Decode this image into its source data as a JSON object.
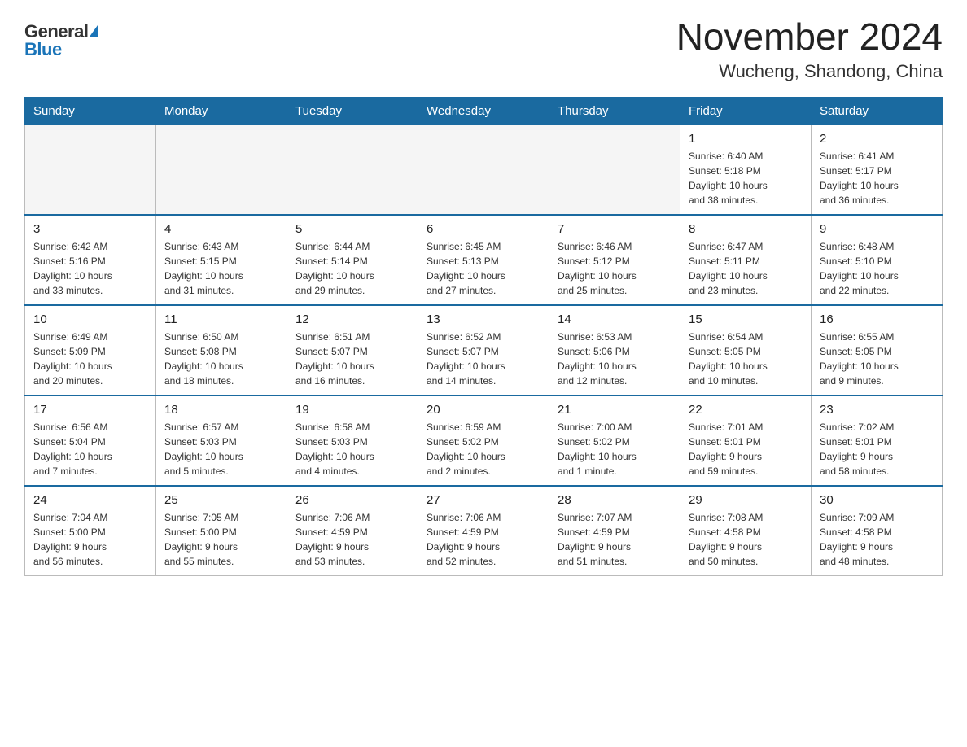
{
  "logo": {
    "general": "General",
    "blue": "Blue"
  },
  "title": "November 2024",
  "location": "Wucheng, Shandong, China",
  "weekdays": [
    "Sunday",
    "Monday",
    "Tuesday",
    "Wednesday",
    "Thursday",
    "Friday",
    "Saturday"
  ],
  "weeks": [
    [
      {
        "day": "",
        "info": ""
      },
      {
        "day": "",
        "info": ""
      },
      {
        "day": "",
        "info": ""
      },
      {
        "day": "",
        "info": ""
      },
      {
        "day": "",
        "info": ""
      },
      {
        "day": "1",
        "info": "Sunrise: 6:40 AM\nSunset: 5:18 PM\nDaylight: 10 hours\nand 38 minutes."
      },
      {
        "day": "2",
        "info": "Sunrise: 6:41 AM\nSunset: 5:17 PM\nDaylight: 10 hours\nand 36 minutes."
      }
    ],
    [
      {
        "day": "3",
        "info": "Sunrise: 6:42 AM\nSunset: 5:16 PM\nDaylight: 10 hours\nand 33 minutes."
      },
      {
        "day": "4",
        "info": "Sunrise: 6:43 AM\nSunset: 5:15 PM\nDaylight: 10 hours\nand 31 minutes."
      },
      {
        "day": "5",
        "info": "Sunrise: 6:44 AM\nSunset: 5:14 PM\nDaylight: 10 hours\nand 29 minutes."
      },
      {
        "day": "6",
        "info": "Sunrise: 6:45 AM\nSunset: 5:13 PM\nDaylight: 10 hours\nand 27 minutes."
      },
      {
        "day": "7",
        "info": "Sunrise: 6:46 AM\nSunset: 5:12 PM\nDaylight: 10 hours\nand 25 minutes."
      },
      {
        "day": "8",
        "info": "Sunrise: 6:47 AM\nSunset: 5:11 PM\nDaylight: 10 hours\nand 23 minutes."
      },
      {
        "day": "9",
        "info": "Sunrise: 6:48 AM\nSunset: 5:10 PM\nDaylight: 10 hours\nand 22 minutes."
      }
    ],
    [
      {
        "day": "10",
        "info": "Sunrise: 6:49 AM\nSunset: 5:09 PM\nDaylight: 10 hours\nand 20 minutes."
      },
      {
        "day": "11",
        "info": "Sunrise: 6:50 AM\nSunset: 5:08 PM\nDaylight: 10 hours\nand 18 minutes."
      },
      {
        "day": "12",
        "info": "Sunrise: 6:51 AM\nSunset: 5:07 PM\nDaylight: 10 hours\nand 16 minutes."
      },
      {
        "day": "13",
        "info": "Sunrise: 6:52 AM\nSunset: 5:07 PM\nDaylight: 10 hours\nand 14 minutes."
      },
      {
        "day": "14",
        "info": "Sunrise: 6:53 AM\nSunset: 5:06 PM\nDaylight: 10 hours\nand 12 minutes."
      },
      {
        "day": "15",
        "info": "Sunrise: 6:54 AM\nSunset: 5:05 PM\nDaylight: 10 hours\nand 10 minutes."
      },
      {
        "day": "16",
        "info": "Sunrise: 6:55 AM\nSunset: 5:05 PM\nDaylight: 10 hours\nand 9 minutes."
      }
    ],
    [
      {
        "day": "17",
        "info": "Sunrise: 6:56 AM\nSunset: 5:04 PM\nDaylight: 10 hours\nand 7 minutes."
      },
      {
        "day": "18",
        "info": "Sunrise: 6:57 AM\nSunset: 5:03 PM\nDaylight: 10 hours\nand 5 minutes."
      },
      {
        "day": "19",
        "info": "Sunrise: 6:58 AM\nSunset: 5:03 PM\nDaylight: 10 hours\nand 4 minutes."
      },
      {
        "day": "20",
        "info": "Sunrise: 6:59 AM\nSunset: 5:02 PM\nDaylight: 10 hours\nand 2 minutes."
      },
      {
        "day": "21",
        "info": "Sunrise: 7:00 AM\nSunset: 5:02 PM\nDaylight: 10 hours\nand 1 minute."
      },
      {
        "day": "22",
        "info": "Sunrise: 7:01 AM\nSunset: 5:01 PM\nDaylight: 9 hours\nand 59 minutes."
      },
      {
        "day": "23",
        "info": "Sunrise: 7:02 AM\nSunset: 5:01 PM\nDaylight: 9 hours\nand 58 minutes."
      }
    ],
    [
      {
        "day": "24",
        "info": "Sunrise: 7:04 AM\nSunset: 5:00 PM\nDaylight: 9 hours\nand 56 minutes."
      },
      {
        "day": "25",
        "info": "Sunrise: 7:05 AM\nSunset: 5:00 PM\nDaylight: 9 hours\nand 55 minutes."
      },
      {
        "day": "26",
        "info": "Sunrise: 7:06 AM\nSunset: 4:59 PM\nDaylight: 9 hours\nand 53 minutes."
      },
      {
        "day": "27",
        "info": "Sunrise: 7:06 AM\nSunset: 4:59 PM\nDaylight: 9 hours\nand 52 minutes."
      },
      {
        "day": "28",
        "info": "Sunrise: 7:07 AM\nSunset: 4:59 PM\nDaylight: 9 hours\nand 51 minutes."
      },
      {
        "day": "29",
        "info": "Sunrise: 7:08 AM\nSunset: 4:58 PM\nDaylight: 9 hours\nand 50 minutes."
      },
      {
        "day": "30",
        "info": "Sunrise: 7:09 AM\nSunset: 4:58 PM\nDaylight: 9 hours\nand 48 minutes."
      }
    ]
  ]
}
